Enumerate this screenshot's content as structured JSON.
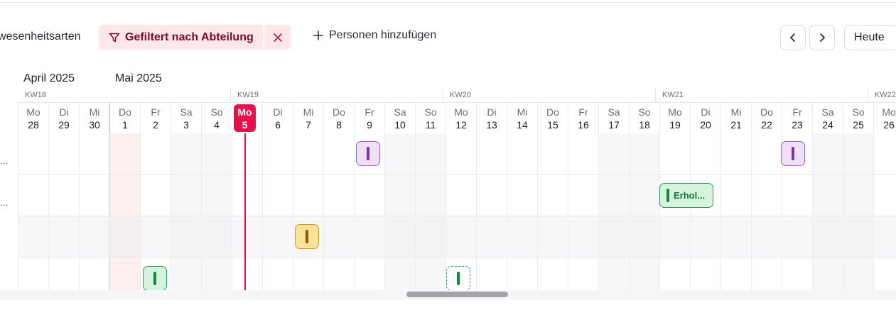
{
  "toolbar": {
    "absence_types_label": "wesenheitsarten",
    "filter_label": "Gefiltert nach Abteilung",
    "add_persons_label": "Personen hinzufügen",
    "today_label": "Heute"
  },
  "calendar": {
    "months": [
      "April 2025",
      "Mai 2025"
    ],
    "weeks": [
      "KW18",
      "KW19",
      "KW20",
      "KW21",
      "KW22"
    ],
    "days": [
      {
        "name": "Mo",
        "date": "28"
      },
      {
        "name": "Di",
        "date": "29"
      },
      {
        "name": "Mi",
        "date": "30"
      },
      {
        "name": "Do",
        "date": "1"
      },
      {
        "name": "Fr",
        "date": "2"
      },
      {
        "name": "Sa",
        "date": "3"
      },
      {
        "name": "So",
        "date": "4"
      },
      {
        "name": "Mo",
        "date": "5"
      },
      {
        "name": "Di",
        "date": "6"
      },
      {
        "name": "Mi",
        "date": "7"
      },
      {
        "name": "Do",
        "date": "8"
      },
      {
        "name": "Fr",
        "date": "9"
      },
      {
        "name": "Sa",
        "date": "10"
      },
      {
        "name": "So",
        "date": "11"
      },
      {
        "name": "Mo",
        "date": "12"
      },
      {
        "name": "Di",
        "date": "13"
      },
      {
        "name": "Mi",
        "date": "14"
      },
      {
        "name": "Do",
        "date": "15"
      },
      {
        "name": "Fr",
        "date": "16"
      },
      {
        "name": "Sa",
        "date": "17"
      },
      {
        "name": "So",
        "date": "18"
      },
      {
        "name": "Mo",
        "date": "19"
      },
      {
        "name": "Di",
        "date": "20"
      },
      {
        "name": "Mi",
        "date": "21"
      },
      {
        "name": "Do",
        "date": "22"
      },
      {
        "name": "Fr",
        "date": "23"
      },
      {
        "name": "Sa",
        "date": "24"
      },
      {
        "name": "So",
        "date": "25"
      },
      {
        "name": "Mo",
        "date": "26"
      }
    ],
    "row_labels": [
      "...",
      "..."
    ],
    "events": {
      "wide_label": "Erhol..."
    },
    "colors": {
      "today": "#e8104a",
      "vacation": "#0f8a3c",
      "purple": "#7b2fb0",
      "yellow": "#8a5a00"
    }
  }
}
